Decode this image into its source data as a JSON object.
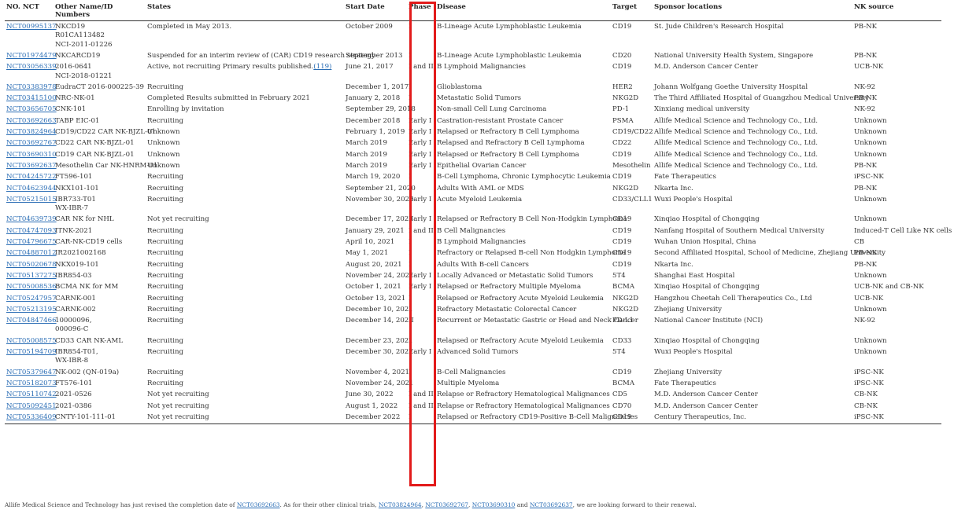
{
  "table": {
    "headers": [
      "NO. NCT",
      "Other Name/ID Numbers",
      "States",
      "Start Date",
      "Phase",
      "Disease",
      "Target",
      "Sponsor locations",
      "NK source"
    ],
    "rows": [
      {
        "nct": "NCT00995137",
        "names": [
          "NKCD19",
          "R01CA113482",
          "NCI-2011-01226"
        ],
        "state": "Completed in May 2013.",
        "date": "October 2009",
        "phase": "I",
        "disease": "B-Lineage Acute Lymphoblastic Leukemia",
        "target": "CD19",
        "sponsor": "St. Jude Children's Research Hospital",
        "source": "PB-NK"
      },
      {
        "nct": "NCT01974479",
        "names": [
          "NKCARCD19"
        ],
        "state": "Suspended for an interim review of (CAR) CD19 research strategy",
        "date": "September 2013",
        "phase": "I",
        "disease": "B-Lineage Acute Lymphoblastic Leukemia",
        "target": "CD20",
        "sponsor": "National University Health System, Singapore",
        "source": "PB-NK"
      },
      {
        "nct": "NCT03056339",
        "names": [
          "2016-0641",
          "NCI-2018-01221"
        ],
        "state": "Active, not recruiting Primary results published.",
        "state_ref": "(119)",
        "date": "June 21, 2017",
        "phase": "I and II",
        "disease": "B Lymphoid Malignancies",
        "target": "CD19",
        "sponsor": "M.D. Anderson Cancer Center",
        "source": "UCB-NK"
      },
      {
        "nct": "NCT03383978",
        "names": [
          "EudraCT 2016-000225-39"
        ],
        "state": "Recruiting",
        "date": "December 1, 2017",
        "phase": "I",
        "disease": "Glioblastoma",
        "target": "HER2",
        "sponsor": "Johann Wolfgang Goethe University Hospital",
        "source": "NK-92"
      },
      {
        "nct": "NCT03415100",
        "names": [
          "NRC-NK-01"
        ],
        "state": "Completed Results submitted in February 2021",
        "date": "January 2, 2018",
        "phase": "I",
        "disease": "Metastatic Solid Tumors",
        "target": "NKG2D",
        "sponsor": "The Third Affiliated Hospital of Guangzhou Medical University",
        "source": "PB-NK"
      },
      {
        "nct": "NCT03656705",
        "names": [
          "CNK-101"
        ],
        "state": "Enrolling by invitation",
        "date": "September 29, 2018",
        "phase": "I",
        "disease": "Non-small Cell Lung Carcinoma",
        "target": "PD-1",
        "sponsor": "Xinxiang medical university",
        "source": "NK-92"
      },
      {
        "nct": "NCT03692663",
        "names": [
          "TABP EIC-01"
        ],
        "state": "Recruiting",
        "date": "December 2018",
        "phase": "Early I",
        "disease": "Castration-resistant Prostate Cancer",
        "target": "PSMA",
        "sponsor": "Allife Medical Science and Technology Co., Ltd.",
        "source": "Unknown"
      },
      {
        "nct": "NCT03824964",
        "names": [
          "CD19/CD22 CAR NK-BJZL-01"
        ],
        "state": "Unknown",
        "date": "February 1, 2019",
        "phase": "Early I",
        "disease": "Relapsed or Refractory B Cell Lymphoma",
        "target": "CD19/CD22",
        "sponsor": "Allife Medical Science and Technology Co., Ltd.",
        "source": "Unknown"
      },
      {
        "nct": "NCT03692767",
        "names": [
          "CD22 CAR NK-BJZL-01"
        ],
        "state": "Unknown",
        "date": "March 2019",
        "phase": "Early I",
        "disease": "Relapsed and Refractory B Cell Lymphoma",
        "target": "CD22",
        "sponsor": "Allife Medical Science and Technology Co., Ltd.",
        "source": "Unknown"
      },
      {
        "nct": "NCT03690310",
        "names": [
          "CD19 CAR NK-BJZL-01"
        ],
        "state": "Unknown",
        "date": "March 2019",
        "phase": "Early I",
        "disease": "Relapsed or Refractory B Cell Lymphoma",
        "target": "CD19",
        "sponsor": "Allife Medical Science and Technology Co., Ltd.",
        "source": "Unknown"
      },
      {
        "nct": "NCT03692637",
        "names": [
          "Mesothelin Car NK-HNRM-01"
        ],
        "state": "Unknown",
        "date": "March 2019",
        "phase": "Early I",
        "disease": "Epithelial Ovarian Cancer",
        "target": "Mesothelin",
        "sponsor": "Allife Medical Science and Technology Co., Ltd.",
        "source": "PB-NK"
      },
      {
        "nct": "NCT04245722",
        "names": [
          "FT596-101"
        ],
        "state": "Recruiting",
        "date": "March 19, 2020",
        "phase": "I",
        "disease": "B-Cell Lymphoma, Chronic Lymphocytic Leukemia",
        "target": "CD19",
        "sponsor": "Fate Therapeutics",
        "source": "iPSC-NK"
      },
      {
        "nct": "NCT04623944",
        "names": [
          "NKX101-101"
        ],
        "state": "Recruiting",
        "date": "September 21, 2020",
        "phase": "I",
        "disease": "Adults With AML or MDS",
        "target": "NKG2D",
        "sponsor": "Nkarta Inc.",
        "source": "PB-NK"
      },
      {
        "nct": "NCT05215015",
        "names": [
          "IBR733-T01",
          "WX-IBR-7"
        ],
        "state": "Recruiting",
        "date": "November 30, 2020",
        "phase": "Early I",
        "disease": "Acute Myeloid Leukemia",
        "target": "CD33/CLL1",
        "sponsor": "Wuxi People's Hospital",
        "source": "Unknown"
      },
      {
        "nct": "NCT04639739",
        "names": [
          "CAR NK for NHL"
        ],
        "state": "Not yet recruiting",
        "date": "December 17, 2020",
        "phase": "Early I",
        "disease": "Relapsed or Refractory B Cell Non-Hodgkin Lymphoma",
        "target": "CD19",
        "sponsor": "Xinqiao Hospital of Chongqing",
        "source": "Unknown"
      },
      {
        "nct": "NCT04747093",
        "names": [
          "ITNK-2021"
        ],
        "state": "Recruiting",
        "date": "January 29, 2021",
        "phase": "I and II",
        "disease": "B Cell Malignancies",
        "target": "CD19",
        "sponsor": "Nanfang Hospital of Southern Medical University",
        "source": "Induced-T Cell Like NK cells"
      },
      {
        "nct": "NCT04796675",
        "names": [
          "CAR-NK-CD19 cells"
        ],
        "state": "Recruiting",
        "date": "April 10, 2021",
        "phase": "I",
        "disease": "B Lymphoid Malignancies",
        "target": "CD19",
        "sponsor": "Wuhan Union Hospital, China",
        "source": "CB"
      },
      {
        "nct": "NCT04887012",
        "names": [
          "IR2021002168"
        ],
        "state": "Recruiting",
        "date": "May 1, 2021",
        "phase": "I",
        "disease": "Refractory or Relapsed B-cell Non Hodgkin Lymphoma",
        "target": "CD19",
        "sponsor": "Second Affiliated Hospital, School of Medicine, Zhejiang University",
        "source": "PB-NK"
      },
      {
        "nct": "NCT05020678",
        "names": [
          "NKX019-101"
        ],
        "state": "Recruiting",
        "date": "August 20, 2021",
        "phase": "I",
        "disease": "Adults With B-cell Cancers",
        "target": "CD19",
        "sponsor": "Nkarta Inc.",
        "source": "PB-NK"
      },
      {
        "nct": "NCT05137275",
        "names": [
          "IBR854-03"
        ],
        "state": "Recruiting",
        "date": "November 24, 2021",
        "phase": "Early I",
        "disease": "Locally Advanced or Metastatic Solid Tumors",
        "target": "5T4",
        "sponsor": "Shanghai East Hospital",
        "source": "Unknown"
      },
      {
        "nct": "NCT05008536",
        "names": [
          "BCMA NK for MM"
        ],
        "state": "Recruiting",
        "date": "October 1, 2021",
        "phase": "Early I",
        "disease": "Relapsed or Refractory Multiple Myeloma",
        "target": "BCMA",
        "sponsor": "Xinqiao Hospital of Chongqing",
        "source": "UCB-NK and CB-NK"
      },
      {
        "nct": "NCT05247957",
        "names": [
          "CARNK-001"
        ],
        "state": "Recruiting",
        "date": "October 13, 2021",
        "phase": "I",
        "disease": "Relapsed or Refractory Acute Myeloid Leukemia",
        "target": "NKG2D",
        "sponsor": "Hangzhou Cheetah Cell Therapeutics Co., Ltd",
        "source": "UCB-NK"
      },
      {
        "nct": "NCT05213195",
        "names": [
          "CARNK-002"
        ],
        "state": "Recruiting",
        "date": "December 10, 2021",
        "phase": "I",
        "disease": "Refractory Metastatic Colorectal Cancer",
        "target": "NKG2D",
        "sponsor": "Zhejiang University",
        "source": "Unknown"
      },
      {
        "nct": "NCT04847466",
        "names": [
          "10000096,",
          "000096-C"
        ],
        "state": "Recruiting",
        "date": "December 14, 2021",
        "phase": "II",
        "disease": "Recurrent or Metastatic Gastric or Head and Neck Cancer",
        "target": "PD-L1",
        "sponsor": "National Cancer Institute (NCI)",
        "source": "NK-92"
      },
      {
        "nct": "NCT05008575",
        "names": [
          "CD33 CAR NK-AML"
        ],
        "state": "Recruiting",
        "date": "December 23, 2021",
        "phase": "I",
        "disease": "Relapsed or Refractory Acute Myeloid Leukemia",
        "target": "CD33",
        "sponsor": "Xinqiao Hospital of Chongqing",
        "source": "Unknown"
      },
      {
        "nct": "NCT05194709",
        "names": [
          "IBR854-T01,",
          "WX-IBR-8"
        ],
        "state": "Recruiting",
        "date": "December 30, 2021",
        "phase": "Early I",
        "disease": "Advanced Solid Tumors",
        "target": "5T4",
        "sponsor": "Wuxi People's Hospital",
        "source": "Unknown"
      },
      {
        "nct": "NCT05379647",
        "names": [
          "NK-002 (QN-019a)"
        ],
        "state": "Recruiting",
        "date": "November 4, 2021",
        "phase": "I",
        "disease": "B-Cell Malignancies",
        "target": "CD19",
        "sponsor": "Zhejiang University",
        "source": "iPSC-NK"
      },
      {
        "nct": "NCT05182073",
        "names": [
          "FT576-101"
        ],
        "state": "Recruiting",
        "date": "November 24, 2021",
        "phase": "I",
        "disease": "Multiple Myeloma",
        "target": "BCMA",
        "sponsor": "Fate Therapeutics",
        "source": "iPSC-NK"
      },
      {
        "nct": "NCT05110742",
        "names": [
          "2021-0526"
        ],
        "state": "Not yet recruiting",
        "date": "June 30, 2022",
        "phase": "I and II",
        "disease": "Relapse or Refractory Hematological Malignances",
        "target": "CD5",
        "sponsor": "M.D. Anderson Cancer Center",
        "source": "CB-NK"
      },
      {
        "nct": "NCT05092451",
        "names": [
          "2021-0386"
        ],
        "state": "Not yet recruiting",
        "date": "August 1, 2022",
        "phase": "I and II",
        "disease": "Relapse or Refractory Hematological Malignances",
        "target": "CD70",
        "sponsor": "M.D. Anderson Cancer Center",
        "source": "CB-NK"
      },
      {
        "nct": "NCT05336409",
        "names": [
          "CNTY-101-111-01"
        ],
        "state": "Not yet recruiting",
        "date": "December 2022",
        "phase": "I",
        "disease": "Relapsed or Refractory CD19-Positive B-Cell Malignancies",
        "target": "CD19",
        "sponsor": "Century Therapeutics, Inc.",
        "source": "iPSC-NK"
      }
    ]
  },
  "footnote": {
    "text_a": "Allife Medical Science and Technology has just revised the completion date of ",
    "link_a": "NCT03692663",
    "text_b": ". As for their other clinical trials, ",
    "link_b": "NCT03824964",
    "sep_1": ", ",
    "link_c": "NCT03692767",
    "sep_2": ", ",
    "link_d": "NCT03690310",
    "text_c": " and ",
    "link_e": "NCT03692637",
    "text_d": ", we are looking forward to their renewal."
  },
  "highlight_color": "#e21a1a",
  "link_color": "#2a6db5"
}
